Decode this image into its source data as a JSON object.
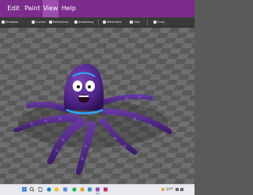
{
  "menu": {
    "items": [
      "Edit",
      "Paint",
      "View",
      "Help"
    ],
    "active": "View"
  },
  "toolbar": {
    "shadows": "Shadows",
    "curves": "Curves",
    "reflections": "Reflections",
    "smoothing": "Smoothing",
    "wireframe": "Wireframe",
    "grid": "Grid",
    "xray": "X-ray"
  },
  "taskbar": {
    "weather": "24°F",
    "time": "",
    "icons": [
      "windows-icon",
      "search-icon",
      "task-view-icon",
      "edge-icon",
      "explorer-icon",
      "store-icon",
      "spotify-icon",
      "chrome-icon",
      "photos-icon",
      "3d-viewer-icon",
      "paint-icon"
    ]
  },
  "colors": {
    "title_bar": "#7b2c8c",
    "octopus_body": "#5b2a8f",
    "octopus_dark": "#3a1a66",
    "collar": "#2aa8ff",
    "viewport_bg": "#676767"
  }
}
